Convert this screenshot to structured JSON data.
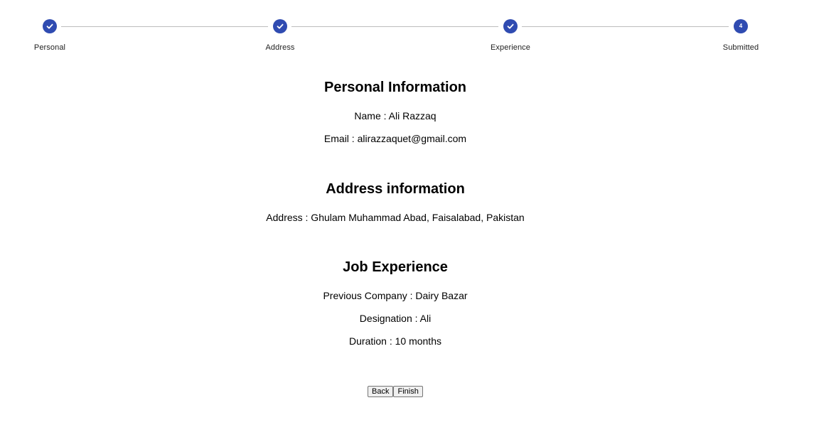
{
  "stepper": {
    "steps": [
      {
        "label": "Personal",
        "state": "complete",
        "icon": "check-icon"
      },
      {
        "label": "Address",
        "state": "complete",
        "icon": "check-icon"
      },
      {
        "label": "Experience",
        "state": "complete",
        "icon": "check-icon"
      },
      {
        "label": "Submitted",
        "state": "active",
        "number": "4"
      }
    ],
    "active_color": "#2f4bb1",
    "connector_color": "#bdbdbd"
  },
  "personal": {
    "title": "Personal Information",
    "name": "Name : Ali Razzaq",
    "email": "Email : alirazzaquet@gmail.com"
  },
  "address": {
    "title": "Address information",
    "address": "Address : Ghulam Muhammad Abad, Faisalabad, Pakistan"
  },
  "experience": {
    "title": "Job Experience",
    "company": "Previous Company : Dairy Bazar",
    "designation": "Designation : Ali",
    "duration": "Duration : 10 months"
  },
  "actions": {
    "back_label": "Back",
    "finish_label": "Finish"
  }
}
